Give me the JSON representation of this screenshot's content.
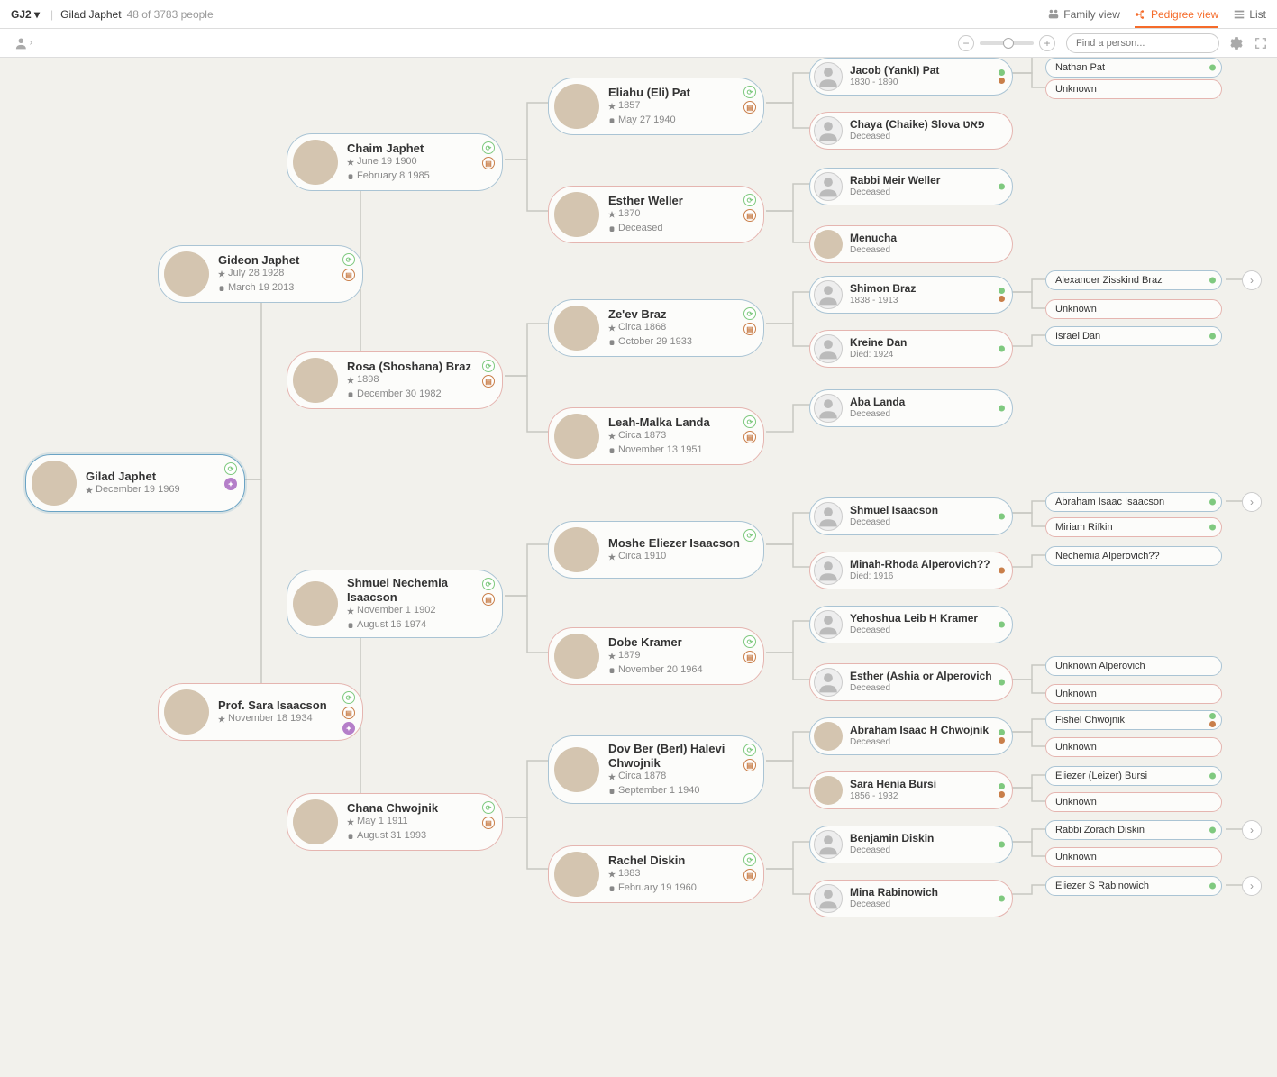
{
  "header": {
    "tree_name": "GJ2",
    "person_name": "Gilad Japhet",
    "count_text": "48 of 3783 people",
    "family_view": "Family view",
    "pedigree_view": "Pedigree view",
    "list_view": "List",
    "search_placeholder": "Find a person..."
  },
  "people": {
    "p0": {
      "name": "Gilad Japhet",
      "birth": "December 19 1969"
    },
    "p1": {
      "name": "Gideon Japhet",
      "birth": "July 28 1928",
      "death": "March 19 2013"
    },
    "p2": {
      "name": "Prof. Sara Isaacson",
      "birth": "November 18 1934"
    },
    "p3": {
      "name": "Chaim Japhet",
      "birth": "June 19 1900",
      "death": "February 8 1985"
    },
    "p4": {
      "name": "Rosa (Shoshana) Braz",
      "birth": "1898",
      "death": "December 30 1982"
    },
    "p5": {
      "name": "Shmuel Nechemia Isaacson",
      "birth": "November 1 1902",
      "death": "August 16 1974"
    },
    "p6": {
      "name": "Chana Chwojnik",
      "birth": "May 1 1911",
      "death": "August 31 1993"
    },
    "p7": {
      "name": "Eliahu (Eli) Pat",
      "birth": "1857",
      "death": "May 27 1940"
    },
    "p8": {
      "name": "Esther Weller",
      "birth": "1870",
      "death": "Deceased"
    },
    "p9": {
      "name": "Ze'ev Braz",
      "birth": "Circa 1868",
      "death": "October 29 1933"
    },
    "p10": {
      "name": "Leah-Malka Landa",
      "birth": "Circa 1873",
      "death": "November 13 1951"
    },
    "p11": {
      "name": "Moshe Eliezer Isaacson",
      "birth": "Circa 1910"
    },
    "p12": {
      "name": "Dobe Kramer",
      "birth": "1879",
      "death": "November 20 1964"
    },
    "p13": {
      "name": "Dov Ber (Berl) Halevi Chwojnik",
      "birth": "Circa 1878",
      "death": "September 1 1940"
    },
    "p14": {
      "name": "Rachel Diskin",
      "birth": "1883",
      "death": "February 19 1960"
    },
    "p15": {
      "name": "Jacob (Yankl) Pat",
      "dates": "1830 - 1890"
    },
    "p16": {
      "name": "Chaya (Chaike) Slova פאט",
      "dates": "Deceased"
    },
    "p17": {
      "name": "Rabbi Meir Weller",
      "dates": "Deceased"
    },
    "p18": {
      "name": "Menucha",
      "dates": "Deceased"
    },
    "p19": {
      "name": "Shimon Braz",
      "dates": "1838 - 1913"
    },
    "p20": {
      "name": "Kreine Dan",
      "dates": "Died: 1924"
    },
    "p21": {
      "name": "Aba Landa",
      "dates": "Deceased"
    },
    "p22": {
      "name": "Shmuel Isaacson",
      "dates": "Deceased"
    },
    "p23": {
      "name": "Minah-Rhoda Alperovich??",
      "dates": "Died: 1916"
    },
    "p24": {
      "name": "Yehoshua Leib H Kramer",
      "dates": "Deceased"
    },
    "p25": {
      "name": "Esther (Ashia or Alperovich",
      "dates": "Deceased"
    },
    "p26": {
      "name": "Abraham Isaac H Chwojnik",
      "dates": "Deceased"
    },
    "p27": {
      "name": "Sara Henia Bursi",
      "dates": "1856 - 1932"
    },
    "p28": {
      "name": "Benjamin Diskin",
      "dates": "Deceased"
    },
    "p29": {
      "name": "Mina Rabinowich",
      "dates": "Deceased"
    },
    "t1": "Nathan Pat",
    "t2": "Unknown",
    "t3": "Alexander Zisskind Braz",
    "t4": "Unknown",
    "t5": "Israel Dan",
    "t6": "Abraham Isaac Isaacson",
    "t7": "Miriam Rifkin",
    "t8": "Nechemia Alperovich??",
    "t9": "Unknown Alperovich",
    "t10": "Unknown",
    "t11": "Fishel Chwojnik",
    "t12": "Unknown",
    "t13": "Eliezer (Leizer) Bursi",
    "t14": "Unknown",
    "t15": "Rabbi Zorach Diskin",
    "t16": "Unknown",
    "t17": "Eliezer S Rabinowich"
  }
}
